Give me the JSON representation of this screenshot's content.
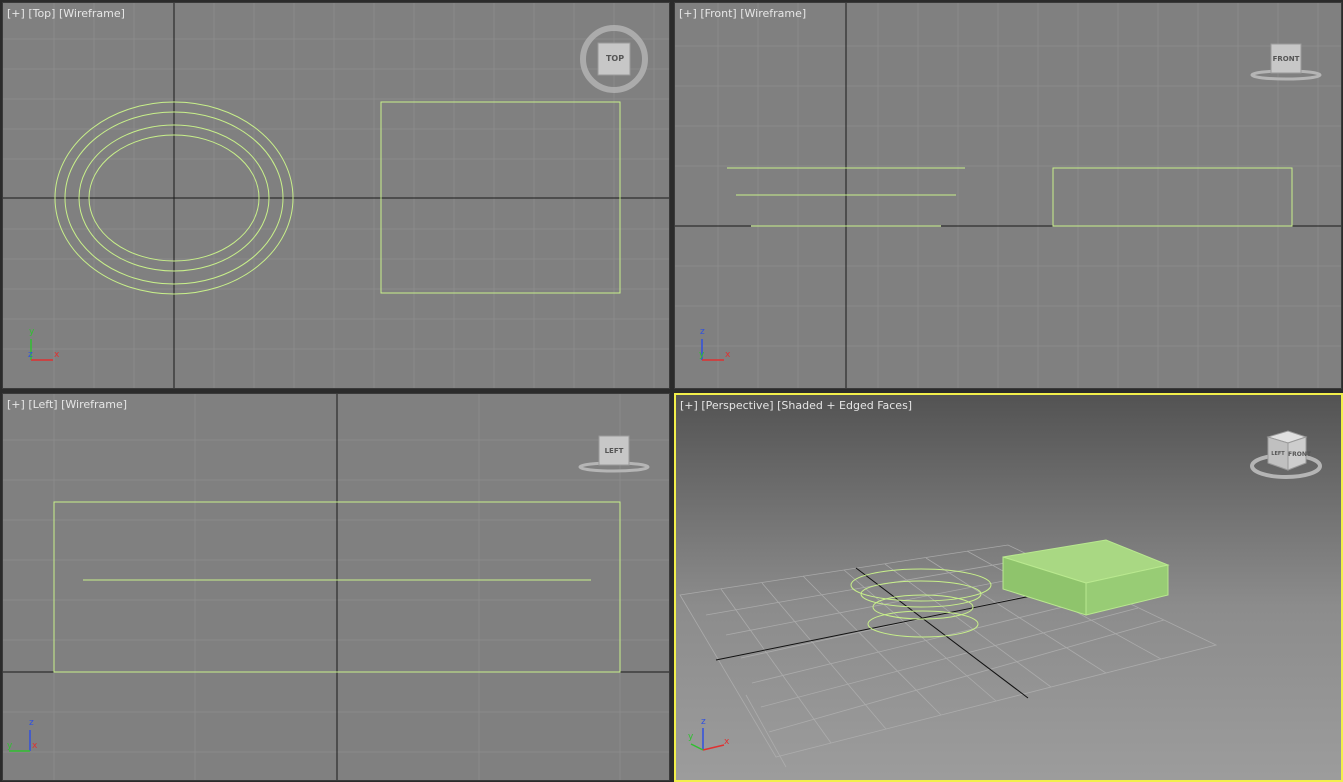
{
  "viewports": {
    "top": {
      "menu": "[+]",
      "view": "[Top]",
      "mode": "[Wireframe]",
      "cube_label": "TOP",
      "axis_labels": {
        "up": "y",
        "out": "z",
        "right": "x"
      }
    },
    "front": {
      "menu": "[+]",
      "view": "[Front]",
      "mode": "[Wireframe]",
      "cube_label": "FRONT",
      "axis_labels": {
        "up": "z",
        "out": "y",
        "right": "x"
      }
    },
    "left": {
      "menu": "[+]",
      "view": "[Left]",
      "mode": "[Wireframe]",
      "cube_label": "LEFT",
      "axis_labels": {
        "up": "z",
        "out": "x",
        "right": "y"
      }
    },
    "perspective": {
      "menu": "[+]",
      "view": "[Perspective]",
      "mode": "[Shaded + Edged Faces]",
      "cube_label": "FRONT",
      "cube_side_label": "LEFT",
      "axis_labels": {
        "up": "z",
        "out": "y",
        "right": "x"
      }
    }
  },
  "colors": {
    "viewport_bg": "#808080",
    "grid": "#8a8a8a",
    "selected_wire": "#c8f08a",
    "active_border": "#f2ef4b",
    "box_fill": "#9fd178",
    "axis_x": "#e03030",
    "axis_y": "#30c030",
    "axis_z": "#3050e0"
  },
  "active_viewport": "perspective"
}
